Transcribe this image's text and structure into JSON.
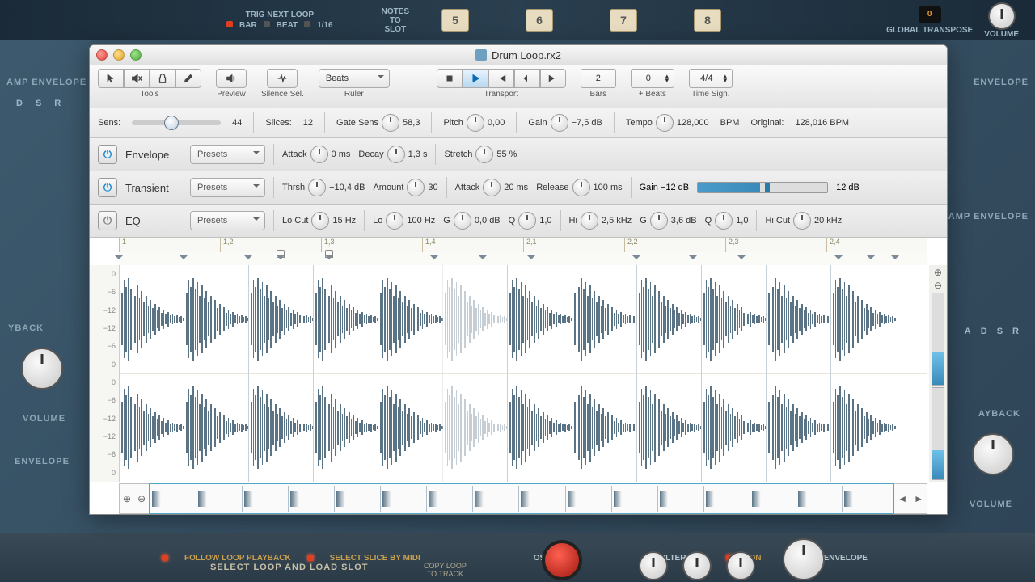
{
  "background": {
    "trig_label": "TRIG NEXT LOOP",
    "trig_bar": "BAR",
    "trig_beat": "BEAT",
    "trig_16": "1/16",
    "notes_label": "NOTES\nTO\nSLOT",
    "slots": [
      "5",
      "6",
      "7",
      "8"
    ],
    "global_transpose_val": "0",
    "global_transpose": "GLOBAL TRANSPOSE",
    "volume": "VOLUME",
    "envelope": "ENVELOPE",
    "amp_envelope": "AMP ENVELOPE",
    "filter_envelope": "FILTER ENVELOPE",
    "playback": "PLAYBACK",
    "adsr": [
      "A",
      "D",
      "S",
      "R"
    ],
    "dsr": [
      "D",
      "S",
      "R"
    ],
    "osc_pitch": "OSC PITCH",
    "filter": "FILTER"
  },
  "window": {
    "title": "Drum Loop.rx2"
  },
  "toolbar": {
    "tools": "Tools",
    "preview": "Preview",
    "silence": "Silence Sel.",
    "ruler": "Ruler",
    "ruler_value": "Beats",
    "transport": "Transport",
    "bars": "Bars",
    "bars_value": "2",
    "beats": "+ Beats",
    "beats_value": "0",
    "timesign": "Time Sign.",
    "timesign_value": "4/4"
  },
  "params_row1": {
    "sens": "Sens:",
    "sens_value": "44",
    "slices": "Slices:",
    "slices_value": "12",
    "gatesens": "Gate Sens",
    "gatesens_value": "58,3",
    "pitch": "Pitch",
    "pitch_value": "0,00",
    "gain": "Gain",
    "gain_value": "−7,5 dB",
    "tempo": "Tempo",
    "tempo_value": "128,000",
    "bpm": "BPM",
    "original": "Original:",
    "original_value": "128,016 BPM"
  },
  "envelope": {
    "name": "Envelope",
    "presets": "Presets",
    "attack": "Attack",
    "attack_value": "0 ms",
    "decay": "Decay",
    "decay_value": "1,3 s",
    "stretch": "Stretch",
    "stretch_value": "55 %"
  },
  "transient": {
    "name": "Transient",
    "presets": "Presets",
    "thrsh": "Thrsh",
    "thrsh_value": "−10,4 dB",
    "amount": "Amount",
    "amount_value": "30",
    "attack": "Attack",
    "attack_value": "20 ms",
    "release": "Release",
    "release_value": "100 ms",
    "gain_low": "Gain −12 dB",
    "gain_hi": "12 dB"
  },
  "eq": {
    "name": "EQ",
    "presets": "Presets",
    "locut": "Lo Cut",
    "locut_value": "15 Hz",
    "lo": "Lo",
    "lo_value": "100 Hz",
    "g1": "G",
    "g1_value": "0,0 dB",
    "q1": "Q",
    "q1_value": "1,0",
    "hi": "Hi",
    "hi_value": "2,5 kHz",
    "g2": "G",
    "g2_value": "3,6 dB",
    "q2": "Q",
    "q2_value": "1,0",
    "hicut": "Hi Cut",
    "hicut_value": "20 kHz"
  },
  "ruler_ticks": [
    "1",
    "1,2",
    "1,3",
    "1,4",
    "2,1",
    "2,2",
    "2,3",
    "2,4"
  ],
  "db_labels": [
    "0",
    "−6",
    "−12",
    "−12",
    "−6",
    "0",
    "0",
    "−6",
    "−12",
    "−12",
    "−6",
    "0"
  ],
  "slice_positions": [
    0,
    8,
    16,
    24,
    32,
    40,
    48,
    56,
    64,
    72,
    80,
    88
  ],
  "slice_markers": [
    {
      "pos": 0,
      "locked": false
    },
    {
      "pos": 8,
      "locked": false
    },
    {
      "pos": 16,
      "locked": false
    },
    {
      "pos": 20,
      "locked": true
    },
    {
      "pos": 26,
      "locked": true
    },
    {
      "pos": 39,
      "locked": false
    },
    {
      "pos": 45,
      "locked": false
    },
    {
      "pos": 51,
      "locked": false
    },
    {
      "pos": 64,
      "locked": false
    },
    {
      "pos": 71,
      "locked": false
    },
    {
      "pos": 77,
      "locked": false
    },
    {
      "pos": 89,
      "locked": false
    },
    {
      "pos": 93,
      "locked": false
    },
    {
      "pos": 96,
      "locked": false
    }
  ],
  "bottom": {
    "follow": "FOLLOW  LOOP  PLAYBACK",
    "select_midi": "SELECT SLICE BY MIDI",
    "select_loop": "SELECT LOOP AND LOAD SLOT",
    "copy_loop": "COPY LOOP\nTO TRACK",
    "on": "ON"
  }
}
